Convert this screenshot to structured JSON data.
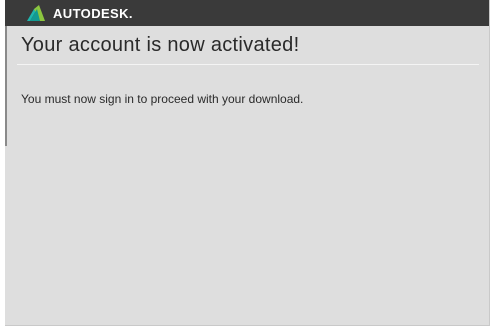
{
  "brand": {
    "name": "AUTODESK.",
    "logo_icon": "autodesk-logo-icon",
    "bar_color": "#3a3a3a"
  },
  "main": {
    "title": "Your account is now activated!",
    "message": "You must now sign in to proceed with your download."
  },
  "colors": {
    "background": "#dedede",
    "text": "#2a2a2a",
    "logo_teal": "#1fb5ad",
    "logo_green": "#8cc63f"
  }
}
